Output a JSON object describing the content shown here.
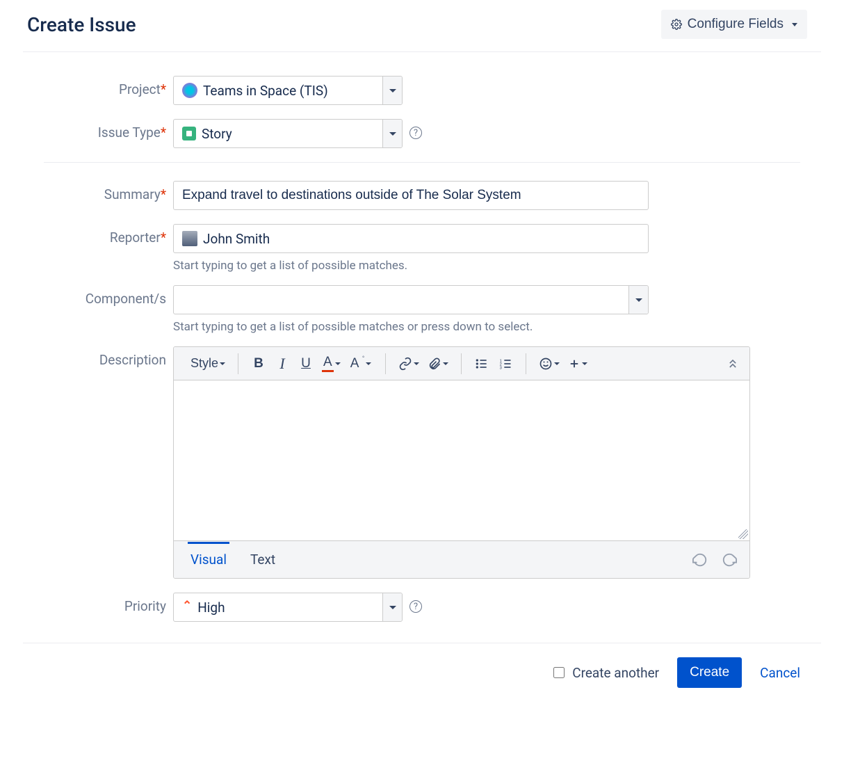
{
  "header": {
    "title": "Create Issue",
    "configure": "Configure Fields"
  },
  "fields": {
    "project": {
      "label": "Project",
      "value": "Teams in Space (TIS)"
    },
    "issueType": {
      "label": "Issue Type",
      "value": "Story"
    },
    "summary": {
      "label": "Summary",
      "value": "Expand travel to destinations outside of The Solar System"
    },
    "reporter": {
      "label": "Reporter",
      "value": "John Smith",
      "hint": "Start typing to get a list of possible matches."
    },
    "components": {
      "label": "Component/s",
      "hint": "Start typing to get a list of possible matches or press down to select."
    },
    "description": {
      "label": "Description",
      "styleLabel": "Style",
      "tabVisual": "Visual",
      "tabText": "Text"
    },
    "priority": {
      "label": "Priority",
      "value": "High"
    }
  },
  "footer": {
    "createAnother": "Create another",
    "create": "Create",
    "cancel": "Cancel"
  }
}
